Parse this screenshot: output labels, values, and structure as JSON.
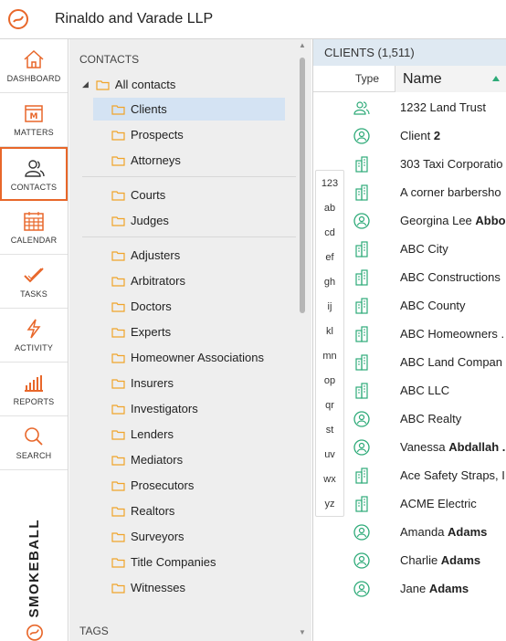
{
  "app": {
    "firm_name": "Rinaldo and Varade LLP",
    "accent_color": "#e8672a",
    "icon_color": "#2daa78"
  },
  "nav": {
    "items": [
      {
        "label": "DASHBOARD",
        "icon": "house-icon"
      },
      {
        "label": "MATTERS",
        "icon": "calendar-m-icon"
      },
      {
        "label": "CONTACTS",
        "icon": "people-icon",
        "active": true
      },
      {
        "label": "CALENDAR",
        "icon": "calendar-grid-icon"
      },
      {
        "label": "TASKS",
        "icon": "checkmark-icon"
      },
      {
        "label": "ACTIVITY",
        "icon": "lightning-icon"
      },
      {
        "label": "REPORTS",
        "icon": "bar-chart-icon"
      },
      {
        "label": "SEARCH",
        "icon": "search-icon"
      }
    ],
    "brand": "SMOKEBALL"
  },
  "tree": {
    "section_title": "CONTACTS",
    "root_label": "All contacts",
    "group1": [
      "Clients",
      "Prospects",
      "Attorneys"
    ],
    "group2": [
      "Courts",
      "Judges"
    ],
    "group3": [
      "Adjusters",
      "Arbitrators",
      "Doctors",
      "Experts",
      "Homeowner Associations",
      "Insurers",
      "Investigators",
      "Lenders",
      "Mediators",
      "Prosecutors",
      "Realtors",
      "Surveyors",
      "Title Companies",
      "Witnesses"
    ],
    "tags_title": "TAGS"
  },
  "clients": {
    "header": "CLIENTS (1,511)",
    "col_type": "Type",
    "col_name": "Name",
    "rows": [
      {
        "type": "group",
        "pre": "1232 Land Trust",
        "bold": ""
      },
      {
        "type": "person",
        "pre": "Client ",
        "bold": "2"
      },
      {
        "type": "company",
        "pre": "303 Taxi Corporatio",
        "bold": ""
      },
      {
        "type": "company",
        "pre": "A corner barbersho",
        "bold": ""
      },
      {
        "type": "person",
        "pre": "Georgina Lee ",
        "bold": "Abbo"
      },
      {
        "type": "company",
        "pre": "ABC City",
        "bold": ""
      },
      {
        "type": "company",
        "pre": "ABC Constructions",
        "bold": ""
      },
      {
        "type": "company",
        "pre": "ABC County",
        "bold": ""
      },
      {
        "type": "company",
        "pre": "ABC Homeowners .",
        "bold": ""
      },
      {
        "type": "company",
        "pre": "ABC Land Compan",
        "bold": ""
      },
      {
        "type": "company",
        "pre": "ABC LLC",
        "bold": ""
      },
      {
        "type": "person",
        "pre": "ABC Realty",
        "bold": ""
      },
      {
        "type": "person",
        "pre": "Vanessa ",
        "bold": "Abdallah ."
      },
      {
        "type": "company",
        "pre": "Ace Safety Straps, I",
        "bold": ""
      },
      {
        "type": "company",
        "pre": "ACME Electric",
        "bold": ""
      },
      {
        "type": "person",
        "pre": "Amanda ",
        "bold": "Adams"
      },
      {
        "type": "person",
        "pre": "Charlie ",
        "bold": "Adams"
      },
      {
        "type": "person",
        "pre": "Jane ",
        "bold": "Adams"
      }
    ]
  },
  "alphabet": [
    "123",
    "ab",
    "cd",
    "ef",
    "gh",
    "ij",
    "kl",
    "mn",
    "op",
    "qr",
    "st",
    "uv",
    "wx",
    "yz"
  ]
}
